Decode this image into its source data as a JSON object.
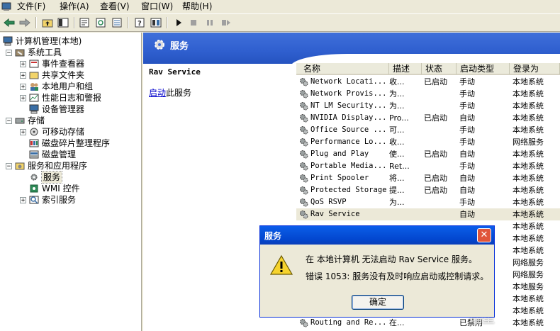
{
  "menu": [
    "文件(F)",
    "操作(A)",
    "查看(V)",
    "窗口(W)",
    "帮助(H)"
  ],
  "icons": {
    "back": "back-arrow-icon",
    "forward": "forward-arrow-icon",
    "up": "up-folder-icon",
    "show_tree": "show-hide-tree-icon",
    "properties": "properties-icon",
    "refresh": "refresh-icon",
    "export": "export-list-icon",
    "help": "help-icon",
    "console": "console-icon",
    "play": "play-icon",
    "stop": "stop-icon",
    "pause": "pause-icon",
    "restart": "restart-icon"
  },
  "tree": {
    "root": "计算机管理(本地)",
    "system_tools": "系统工具",
    "event_viewer": "事件查看器",
    "shared_folders": "共享文件夹",
    "local_users": "本地用户和组",
    "perf_logs": "性能日志和警报",
    "device_manager": "设备管理器",
    "storage": "存储",
    "removable": "可移动存储",
    "defrag": "磁盘碎片整理程序",
    "disk_mgmt": "磁盘管理",
    "services_apps": "服务和应用程序",
    "services": "服务",
    "wmi": "WMI 控件",
    "indexing": "索引服务"
  },
  "header": {
    "title": "服务"
  },
  "detail": {
    "service_name": "Rav Service",
    "start_link": "启动",
    "start_suffix": "此服务"
  },
  "columns": [
    "名称",
    "描述",
    "状态",
    "启动类型",
    "登录为"
  ],
  "rows": [
    [
      "Network Locati...",
      "收...",
      "已启动",
      "手动",
      "本地系统"
    ],
    [
      "Network Provis...",
      "为...",
      "",
      "手动",
      "本地系统"
    ],
    [
      "NT LM Security...",
      "为...",
      "",
      "手动",
      "本地系统"
    ],
    [
      "NVIDIA Display...",
      "Pro...",
      "已启动",
      "自动",
      "本地系统"
    ],
    [
      "Office Source ...",
      "可...",
      "",
      "手动",
      "本地系统"
    ],
    [
      "Performance Lo...",
      "收...",
      "",
      "手动",
      "网络服务"
    ],
    [
      "Plug and Play",
      "使...",
      "已启动",
      "自动",
      "本地系统"
    ],
    [
      "Portable Media...",
      "Ret...",
      "",
      "手动",
      "本地系统"
    ],
    [
      "Print Spooler",
      "将...",
      "已启动",
      "自动",
      "本地系统"
    ],
    [
      "Protected Storage",
      "提...",
      "已启动",
      "自动",
      "本地系统"
    ],
    [
      "QoS RSVP",
      "为...",
      "",
      "手动",
      "本地系统"
    ],
    [
      "Rav Service",
      "",
      "",
      "自动",
      "本地系统"
    ],
    [
      "",
      "",
      "",
      "",
      "本地系统"
    ],
    [
      "",
      "",
      "",
      "",
      "本地系统"
    ],
    [
      "",
      "",
      "",
      "",
      "本地系统"
    ],
    [
      "",
      "",
      "",
      "",
      "网络服务"
    ],
    [
      "",
      "",
      "",
      "",
      "网络服务"
    ],
    [
      "",
      "",
      "",
      "",
      "本地服务"
    ],
    [
      "",
      "",
      "",
      "",
      "本地系统"
    ],
    [
      "",
      "",
      "",
      "",
      "本地系统"
    ],
    [
      "Routing and Re...",
      "在...",
      "",
      "已禁用",
      "本地系统"
    ]
  ],
  "dialog": {
    "title": "服务",
    "line1": "在 本地计算机 无法启动 Rav Service 服务。",
    "line2": "错误 1053: 服务没有及时响应启动或控制请求。",
    "ok": "确定",
    "close_icon": "close-icon",
    "warning_icon": "warning-icon"
  },
  "watermark": "瑞星"
}
